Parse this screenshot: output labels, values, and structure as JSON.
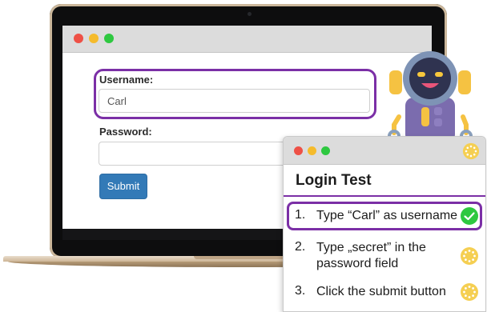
{
  "login_form": {
    "username_label": "Username:",
    "username_value": "Carl",
    "password_label": "Password:",
    "password_value": "",
    "submit_label": "Submit"
  },
  "test_panel": {
    "title": "Login Test",
    "steps": [
      {
        "number": "1.",
        "text": "Type “Carl” as username",
        "status": "done",
        "icon": "check-circle-icon"
      },
      {
        "number": "2.",
        "text": "Type „secret” in the password field",
        "status": "pending",
        "icon": "loading-spinner-icon"
      },
      {
        "number": "3.",
        "text": "Click the submit button",
        "status": "pending",
        "icon": "loading-spinner-icon"
      }
    ]
  },
  "colors": {
    "highlight": "#7b2fa6",
    "submit": "#337ab7",
    "done": "#2ec840",
    "pending": "#f5cf52"
  }
}
